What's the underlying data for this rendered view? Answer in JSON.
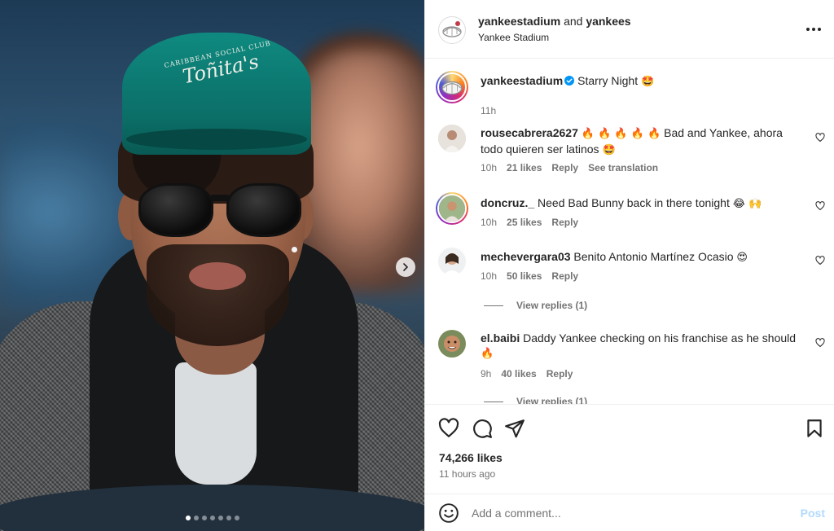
{
  "post": {
    "carousel": {
      "slide_count": 7,
      "active_slide": 1,
      "next_icon": "chevron-right-icon"
    },
    "header": {
      "primary_user": "yankeestadium",
      "joiner": "and",
      "collaborator": "yankees",
      "location": "Yankee Stadium",
      "more_icon": "more-horizontal-icon"
    },
    "caption": {
      "username": "yankeestadium",
      "verified": true,
      "text": "Starry Night",
      "emoji": "🤩",
      "time": "11h"
    },
    "comments": [
      {
        "username": "rousecabrera2627",
        "emoji_prefix": "🔥 🔥 🔥 🔥 🔥",
        "text": "Bad and Yankee, ahora todo quieren ser latinos",
        "emoji_suffix": "🤩",
        "time": "10h",
        "likes": "21 likes",
        "reply": "Reply",
        "translate": "See translation"
      },
      {
        "username": "doncruz._",
        "text": "Need Bad Bunny back in there tonight",
        "emoji_suffix": "😂 🙌",
        "time": "10h",
        "likes": "25 likes",
        "reply": "Reply"
      },
      {
        "username": "mechevergara03",
        "text": "Benito Antonio Martínez Ocasio",
        "emoji_suffix": "😍",
        "time": "10h",
        "likes": "50 likes",
        "reply": "Reply",
        "view_replies": "View replies (1)"
      },
      {
        "username": "el.baibi",
        "text": "Daddy Yankee checking on his franchise as he should",
        "emoji_suffix": "🔥",
        "time": "9h",
        "likes": "40 likes",
        "reply": "Reply",
        "view_replies": "View replies (1)"
      }
    ],
    "actions": {
      "like_icon": "heart-icon",
      "comment_icon": "comment-icon",
      "share_icon": "send-icon",
      "save_icon": "bookmark-icon",
      "likes": "74,266 likes",
      "time_ago": "11 hours ago"
    },
    "add_comment": {
      "placeholder": "Add a comment...",
      "post_label": "Post",
      "emoji_icon": "smiley-icon"
    }
  },
  "colors": {
    "text": "#262626",
    "muted": "#737373",
    "border": "#efefef",
    "verified": "#0095f6",
    "post_disabled": "#b3d9fd",
    "cap_teal": "#0b6e67"
  }
}
